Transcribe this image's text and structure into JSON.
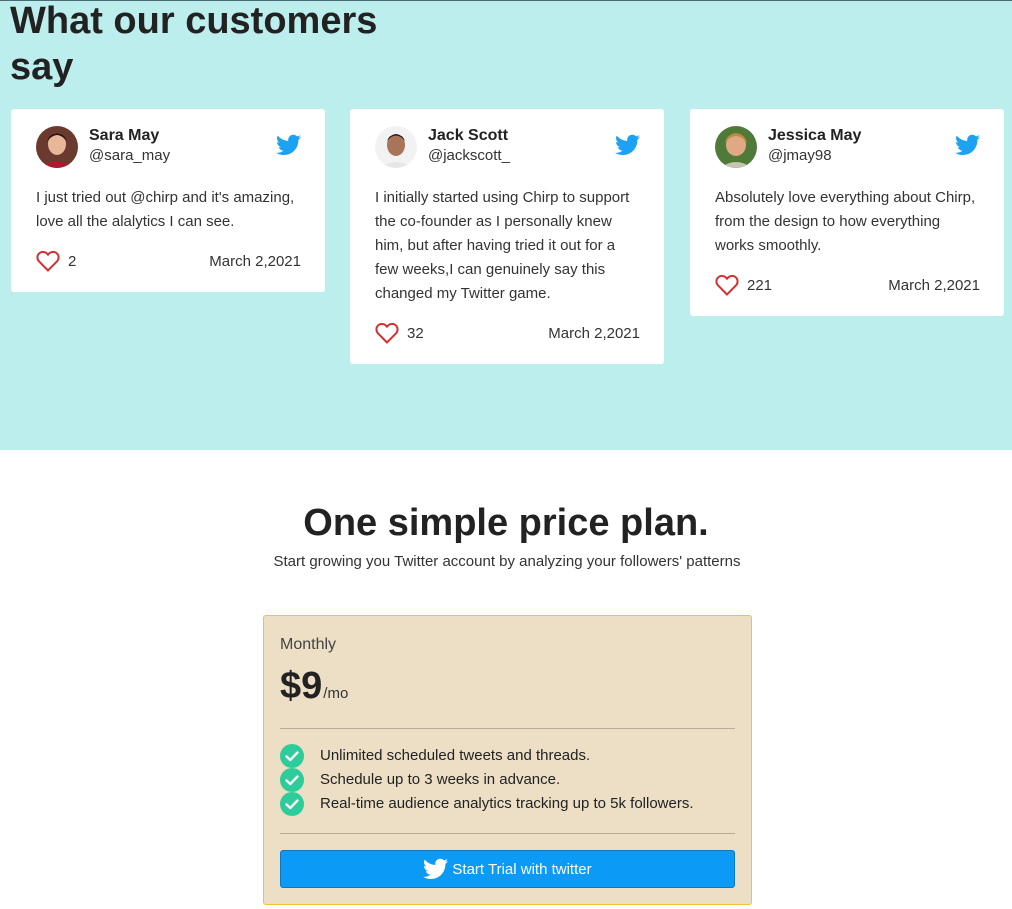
{
  "testimonials": {
    "title": "What our customers say",
    "cards": [
      {
        "name": "Sara May",
        "handle": "@sara_may",
        "quote": "I just tried out @chirp and it's amazing, love all the alalytics I can see.",
        "likes": "2",
        "date": "March 2,2021"
      },
      {
        "name": "Jack Scott",
        "handle": "@jackscott_",
        "quote": "I initially started using Chirp to support the co-founder as I personally knew him, but after having tried it out for a few weeks,I can genuinely say this changed my Twitter game.",
        "likes": "32",
        "date": "March 2,2021"
      },
      {
        "name": "Jessica May",
        "handle": "@jmay98",
        "quote": "Absolutely love everything about Chirp, from the design to how everything works smoothly.",
        "likes": "221",
        "date": "March 2,2021"
      }
    ]
  },
  "pricing": {
    "title": "One simple price plan.",
    "subtitle": "Start growing you Twitter account by analyzing your followers' patterns",
    "plan": {
      "period": "Monthly",
      "price": "$9",
      "unit": "/mo",
      "features": [
        "Unlimited scheduled tweets and threads.",
        "Schedule up to 3 weeks in advance.",
        "Real-time audience analytics tracking up to 5k followers."
      ],
      "cta_label": "Start Trial with twitter"
    }
  },
  "colors": {
    "section_bg": "#bdeeee",
    "twitter_blue": "#1da1f2",
    "heart_red": "#d32f2f",
    "check_green": "#2ecc9a",
    "plan_bg": "#ecdfc6",
    "cta_bg": "#0b9bf7"
  }
}
